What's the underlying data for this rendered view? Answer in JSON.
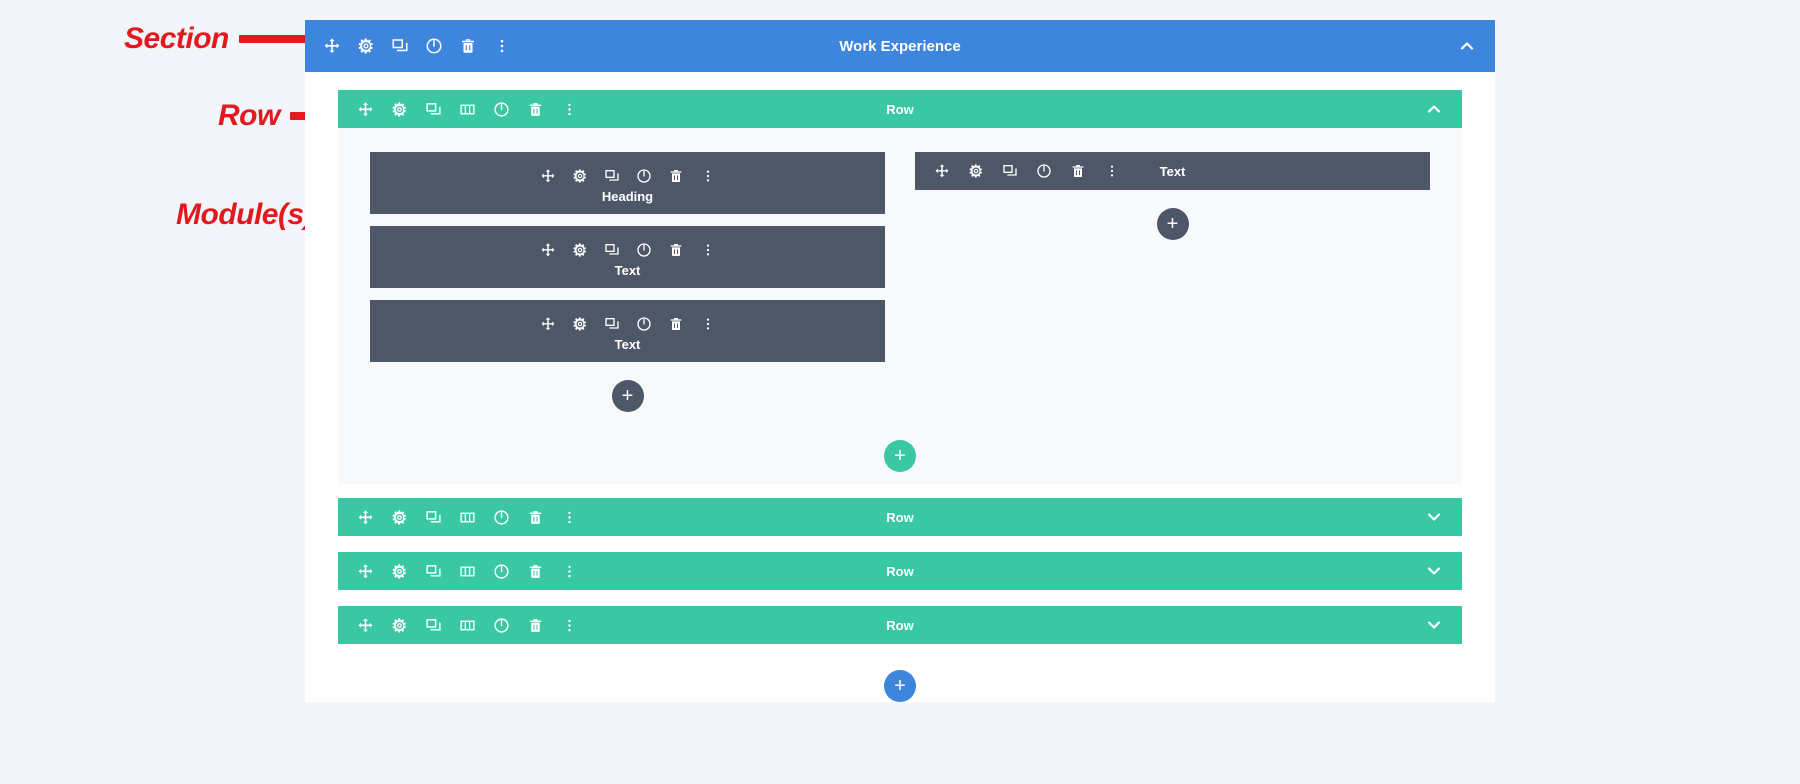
{
  "annotations": [
    {
      "label": "Section",
      "name": "annotation-section"
    },
    {
      "label": "Row",
      "name": "annotation-row"
    },
    {
      "label": "Module(s)",
      "name": "annotation-modules"
    }
  ],
  "colors": {
    "section_blue": "#3e85de",
    "row_green": "#39c7a4",
    "module_slate": "#4d5768",
    "annotation_red": "#e4181f",
    "canvas_white": "#ffffff",
    "page_background": "#f2f5f9"
  },
  "section": {
    "title": "Work Experience",
    "collapse_icon": "chevron-up-icon",
    "toolbar": [
      {
        "icon": "move-icon",
        "label": "Move Section"
      },
      {
        "icon": "gear-icon",
        "label": "Section Settings"
      },
      {
        "icon": "duplicate-icon",
        "label": "Duplicate Section"
      },
      {
        "icon": "power-icon",
        "label": "Disable Section"
      },
      {
        "icon": "trash-icon",
        "label": "Delete Section"
      },
      {
        "icon": "ellipsis-vertical-icon",
        "label": "More Options"
      }
    ],
    "add_section_button": {
      "icon": "plus-icon",
      "label": "+"
    }
  },
  "rows": [
    {
      "title": "Row",
      "expanded": true,
      "collapse_icon": "chevron-up-icon",
      "toolbar": [
        {
          "icon": "move-icon",
          "label": "Move Row"
        },
        {
          "icon": "gear-icon",
          "label": "Row Settings"
        },
        {
          "icon": "duplicate-icon",
          "label": "Duplicate Row"
        },
        {
          "icon": "columns-icon",
          "label": "Change Column Structure"
        },
        {
          "icon": "power-icon",
          "label": "Disable Row"
        },
        {
          "icon": "trash-icon",
          "label": "Delete Row"
        },
        {
          "icon": "ellipsis-vertical-icon",
          "label": "More Options"
        }
      ],
      "columns": [
        {
          "modules": [
            {
              "label": "Heading",
              "layout": "stacked"
            },
            {
              "label": "Text",
              "layout": "stacked"
            },
            {
              "label": "Text",
              "layout": "stacked"
            }
          ],
          "add_module_button": {
            "icon": "plus-icon",
            "label": "+"
          }
        },
        {
          "modules": [
            {
              "label": "Text",
              "layout": "inline"
            }
          ],
          "add_module_button": {
            "icon": "plus-icon",
            "label": "+"
          }
        }
      ],
      "add_row_button": {
        "icon": "plus-icon",
        "label": "+"
      }
    },
    {
      "title": "Row",
      "expanded": false,
      "collapse_icon": "chevron-down-icon",
      "toolbar": [
        {
          "icon": "move-icon",
          "label": "Move Row"
        },
        {
          "icon": "gear-icon",
          "label": "Row Settings"
        },
        {
          "icon": "duplicate-icon",
          "label": "Duplicate Row"
        },
        {
          "icon": "columns-icon",
          "label": "Change Column Structure"
        },
        {
          "icon": "power-icon",
          "label": "Disable Row"
        },
        {
          "icon": "trash-icon",
          "label": "Delete Row"
        },
        {
          "icon": "ellipsis-vertical-icon",
          "label": "More Options"
        }
      ]
    },
    {
      "title": "Row",
      "expanded": false,
      "collapse_icon": "chevron-down-icon",
      "toolbar": [
        {
          "icon": "move-icon",
          "label": "Move Row"
        },
        {
          "icon": "gear-icon",
          "label": "Row Settings"
        },
        {
          "icon": "duplicate-icon",
          "label": "Duplicate Row"
        },
        {
          "icon": "columns-icon",
          "label": "Change Column Structure"
        },
        {
          "icon": "power-icon",
          "label": "Disable Row"
        },
        {
          "icon": "trash-icon",
          "label": "Delete Row"
        },
        {
          "icon": "ellipsis-vertical-icon",
          "label": "More Options"
        }
      ]
    },
    {
      "title": "Row",
      "expanded": false,
      "collapse_icon": "chevron-down-icon",
      "toolbar": [
        {
          "icon": "move-icon",
          "label": "Move Row"
        },
        {
          "icon": "gear-icon",
          "label": "Row Settings"
        },
        {
          "icon": "duplicate-icon",
          "label": "Duplicate Row"
        },
        {
          "icon": "columns-icon",
          "label": "Change Column Structure"
        },
        {
          "icon": "power-icon",
          "label": "Disable Row"
        },
        {
          "icon": "trash-icon",
          "label": "Delete Row"
        },
        {
          "icon": "ellipsis-vertical-icon",
          "label": "More Options"
        }
      ]
    }
  ]
}
